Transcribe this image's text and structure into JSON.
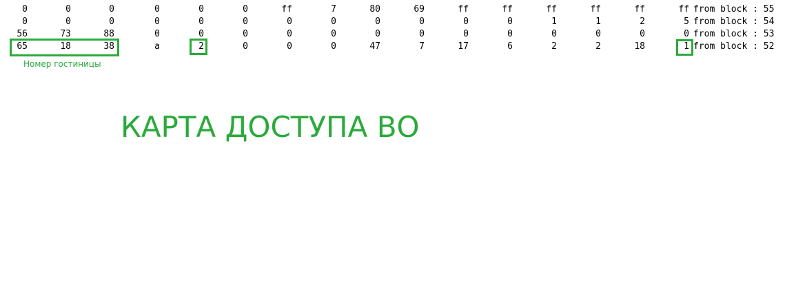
{
  "dump": {
    "rows": [
      {
        "cells": [
          "0",
          "0",
          "0",
          "0",
          "0",
          "0",
          "ff",
          "7",
          "80",
          "69",
          "ff",
          "ff",
          "ff",
          "ff",
          "ff",
          "ff"
        ],
        "suffix": "from block : 55"
      },
      {
        "cells": [
          "0",
          "0",
          "0",
          "0",
          "0",
          "0",
          "0",
          "0",
          "0",
          "0",
          "0",
          "0",
          "1",
          "1",
          "2",
          "5"
        ],
        "suffix": "from block : 54"
      },
      {
        "cells": [
          "56",
          "73",
          "88",
          "0",
          "0",
          "0",
          "0",
          "0",
          "0",
          "0",
          "0",
          "0",
          "0",
          "0",
          "0",
          "0"
        ],
        "suffix": "from block : 53"
      },
      {
        "cells": [
          "65",
          "18",
          "38",
          "a",
          "2",
          "0",
          "0",
          "0",
          "47",
          "7",
          "17",
          "6",
          "2",
          "2",
          "18",
          "1"
        ],
        "suffix": "from block : 52"
      }
    ]
  },
  "annotations": {
    "hotel_number_label": "Номер гостиницы",
    "heading": "КАРТА ДОСТУПА ВО"
  },
  "colors": {
    "annotation_green": "#2aaa3a",
    "text": "#000000",
    "background": "#ffffff"
  }
}
